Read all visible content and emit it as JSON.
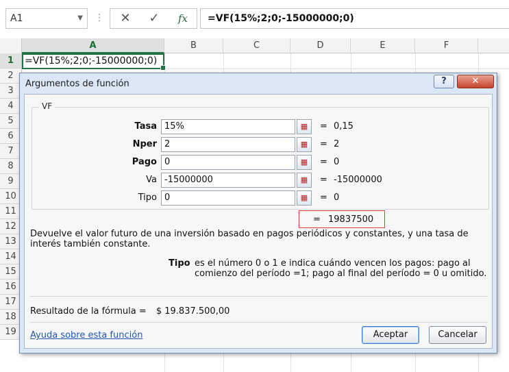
{
  "formula_bar": {
    "name_box": "A1",
    "dots": "⋮",
    "cancel_glyph": "✕",
    "enter_glyph": "✓",
    "fx_glyph": "fx",
    "formula": "=VF(15%;2;0;-15000000;0)"
  },
  "sheet": {
    "columns": [
      "A",
      "B",
      "C",
      "D",
      "E",
      "F"
    ],
    "rows": [
      "1",
      "2",
      "3",
      "4",
      "5",
      "6",
      "7",
      "8",
      "9",
      "10",
      "11",
      "12",
      "13",
      "14",
      "15",
      "16",
      "17",
      "18",
      "19"
    ],
    "cell_a1": "=VF(15%;2;0;-15000000;0)"
  },
  "dialog": {
    "title": "Argumentos de función",
    "help_glyph": "?",
    "close_glyph": "✕",
    "function_name": "VF",
    "ref_glyph": "▦",
    "eq": "=",
    "arguments": [
      {
        "label": "Tasa",
        "value": "15%",
        "result": "0,15",
        "bold": true
      },
      {
        "label": "Nper",
        "value": "2",
        "result": "2",
        "bold": true
      },
      {
        "label": "Pago",
        "value": "0",
        "result": "0",
        "bold": true
      },
      {
        "label": "Va",
        "value": "-15000000",
        "result": "-15000000",
        "bold": false
      },
      {
        "label": "Tipo",
        "value": "0",
        "result": "0",
        "bold": false
      }
    ],
    "result_value": "19837500",
    "description": "Devuelve el valor futuro de una inversión basado en pagos periódicos y constantes, y una tasa de interés también constante.",
    "param_name": "Tipo",
    "param_description": "es el número 0 o 1 e indica cuándo vencen los pagos: pago al comienzo del período =1; pago al final del período = 0 u omitido.",
    "formula_result_label": "Resultado de la fórmula =",
    "formula_result_value": "$ 19.837.500,00",
    "help_link": "Ayuda sobre esta función",
    "ok_label": "Aceptar",
    "cancel_label": "Cancelar"
  },
  "colors": {
    "accent_green": "#217346",
    "result_border": "#e03a3a",
    "link": "#1f56b7"
  }
}
